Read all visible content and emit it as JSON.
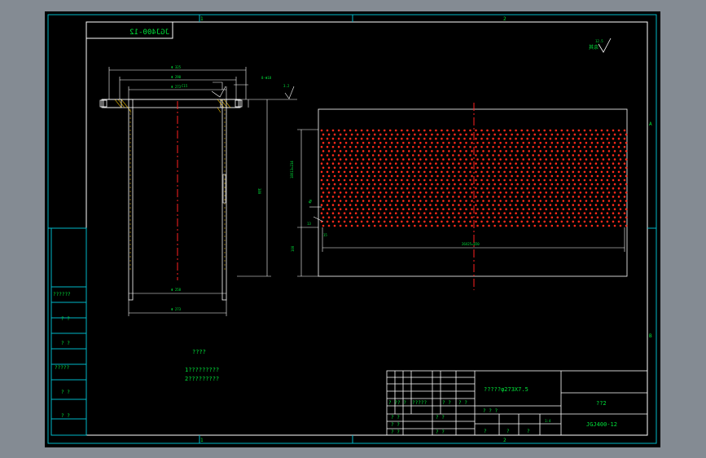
{
  "drawing": {
    "code_stamp_mirrored": "JGJ400-12",
    "grid_top": [
      "1",
      "2"
    ],
    "grid_bottom": [
      "1",
      "2"
    ],
    "grid_right": [
      "A",
      "B"
    ],
    "roughness_mark": "其余",
    "roughness_value": "12.5",
    "roughness_value_small": "3.2",
    "left_stamps": [
      "??????",
      "? ?",
      "? ?",
      "?????",
      "? ?",
      "? ?"
    ],
    "notes_heading": "????",
    "notes": [
      "1?????????",
      "2?????????"
    ]
  },
  "title_block": {
    "part_name": "?????φ273X7.5",
    "material_code": "??2",
    "drawing_number": "JGJ400-12",
    "sign_row": [
      "? ?",
      "? ?",
      "?????",
      "? ?",
      "? ?"
    ],
    "left_rows": [
      "? ?",
      "? ?",
      "? ?"
    ],
    "right_rows": [
      "? ?",
      "? ?"
    ],
    "scale_row": [
      "? ? ?",
      "?",
      "?",
      "?"
    ],
    "scale_value": "1:4"
  },
  "dimensions": {
    "flange_od": "Φ 325",
    "flange_pcd": "Φ 290",
    "flange_id": "Φ 273",
    "hole_note": "8-Φ18",
    "chamfer": "C15",
    "height_total": "380",
    "tube_id": "Φ 258",
    "tube_od": "Φ 273",
    "pattern_width": "26X25=650",
    "pattern_height": "18X13=234",
    "bottom_margin": "100",
    "hole_size": "Φ8",
    "hole_pitch": "13",
    "edge_offset": "15"
  }
}
